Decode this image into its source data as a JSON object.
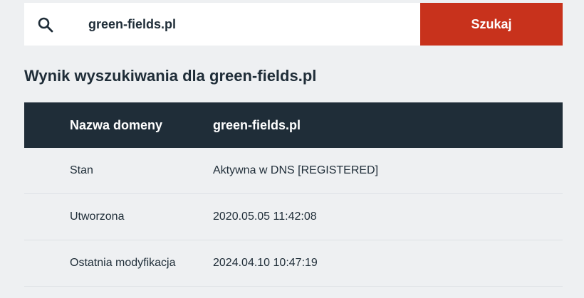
{
  "search": {
    "value": "green-fields.pl",
    "button_label": "Szukaj"
  },
  "result": {
    "heading": "Wynik wyszukiwania dla green-fields.pl",
    "header": {
      "label": "Nazwa domeny",
      "value": "green-fields.pl"
    },
    "rows": [
      {
        "label": "Stan",
        "value": "Aktywna w DNS [REGISTERED]"
      },
      {
        "label": "Utworzona",
        "value": "2020.05.05 11:42:08"
      },
      {
        "label": "Ostatnia modyfikacja",
        "value": "2024.04.10 10:47:19"
      }
    ]
  },
  "colors": {
    "accent": "#c8321c",
    "header_bg": "#1f2d38",
    "page_bg": "#eef0f2"
  },
  "icons": {
    "search": "search-icon"
  }
}
